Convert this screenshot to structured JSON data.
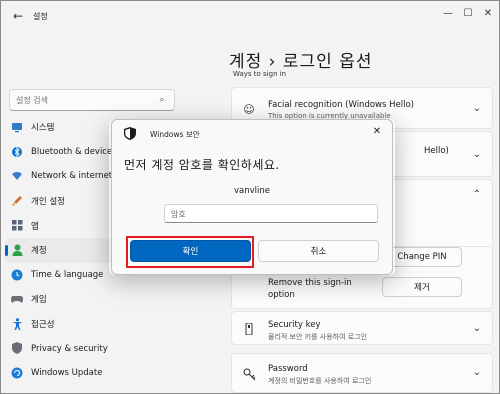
{
  "window": {
    "app_title": "설정",
    "page_title": "계정 › 로그인 옵션"
  },
  "sidebar": {
    "search_placeholder": "설정 검색",
    "items": [
      {
        "label": "시스템",
        "icon": "system-icon",
        "color": "#2f7cc7"
      },
      {
        "label": "Bluetooth & devices",
        "icon": "bluetooth-icon",
        "color": "#0b74d1"
      },
      {
        "label": "Network & internet",
        "icon": "network-icon",
        "color": "#3a7bd5"
      },
      {
        "label": "개인 설정",
        "icon": "personalization-icon",
        "color": "#c9733a"
      },
      {
        "label": "앱",
        "icon": "apps-icon",
        "color": "#5a6575"
      },
      {
        "label": "계정",
        "icon": "account-icon",
        "color": "#2aa14a",
        "active": true
      },
      {
        "label": "Time & language",
        "icon": "clock-globe-icon",
        "color": "#1c7fd6"
      },
      {
        "label": "게임",
        "icon": "gaming-icon",
        "color": "#6b6f75"
      },
      {
        "label": "접근성",
        "icon": "accessibility-icon",
        "color": "#1c6fd6"
      },
      {
        "label": "Privacy & security",
        "icon": "shield-icon",
        "color": "#6b6f75"
      },
      {
        "label": "Windows Update",
        "icon": "update-icon",
        "color": "#1c7fd6"
      }
    ]
  },
  "content": {
    "section_header": "Ways to sign in",
    "facial": {
      "title": "Facial recognition (Windows Hello)",
      "subtitle": "This option is currently unavailable"
    },
    "fingerprint": {
      "title": "Hello)"
    },
    "change_pin_label": "Change PIN",
    "remove": {
      "title": "Remove this sign-in option",
      "button": "제거"
    },
    "security_key": {
      "title": "Security key",
      "subtitle": "물리적 보안 키를 사용하여 로그인"
    },
    "password": {
      "title": "Password",
      "subtitle": "계정의 비밀번호를 사용하여 로그인"
    }
  },
  "dialog": {
    "app_name": "Windows 보안",
    "heading": "먼저 계정 암호를 확인하세요.",
    "username": "vanvline",
    "password_placeholder": "암호",
    "ok_label": "확인",
    "cancel_label": "취소",
    "highlight_color": "#e31c23",
    "accent_color": "#0067c0"
  }
}
